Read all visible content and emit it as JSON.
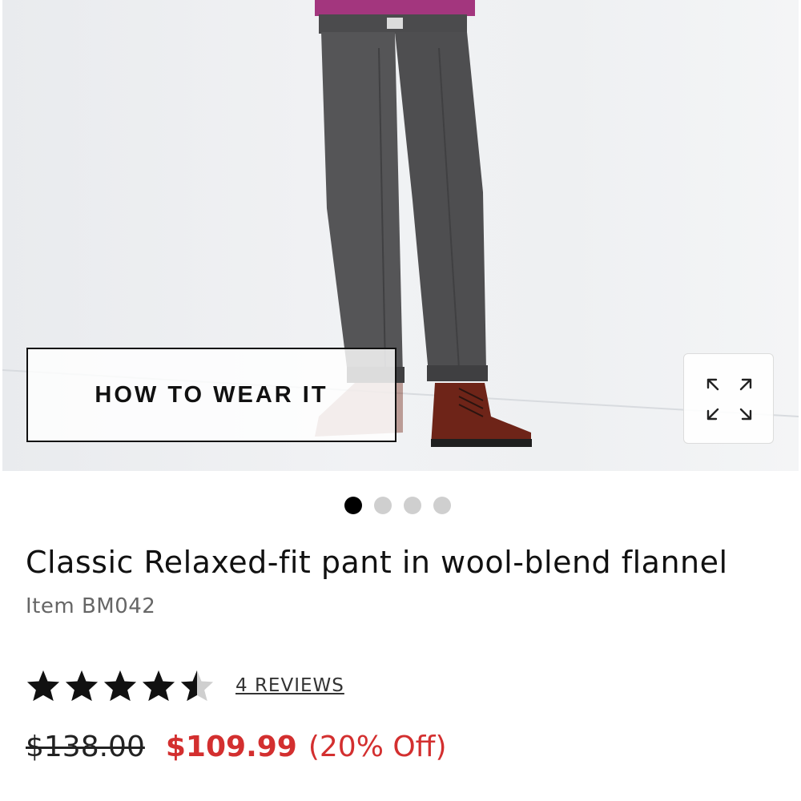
{
  "gallery": {
    "how_to_wear_label": "HOW TO WEAR IT",
    "expand_icon": "expand-arrows-icon",
    "slides_total": 4,
    "active_slide": 1
  },
  "product": {
    "title": "Classic Relaxed-fit pant in wool-blend flannel",
    "item_number": "Item BM042",
    "rating": 4.5,
    "rating_max": 5,
    "reviews_label": "4 REVIEWS",
    "price_original": "$138.00",
    "price_sale": "$109.99",
    "discount": "(20% Off)"
  },
  "colors": {
    "sale": "#d32f2f",
    "text": "#111111",
    "muted": "#666666",
    "dot_inactive": "#cfcfcf"
  }
}
